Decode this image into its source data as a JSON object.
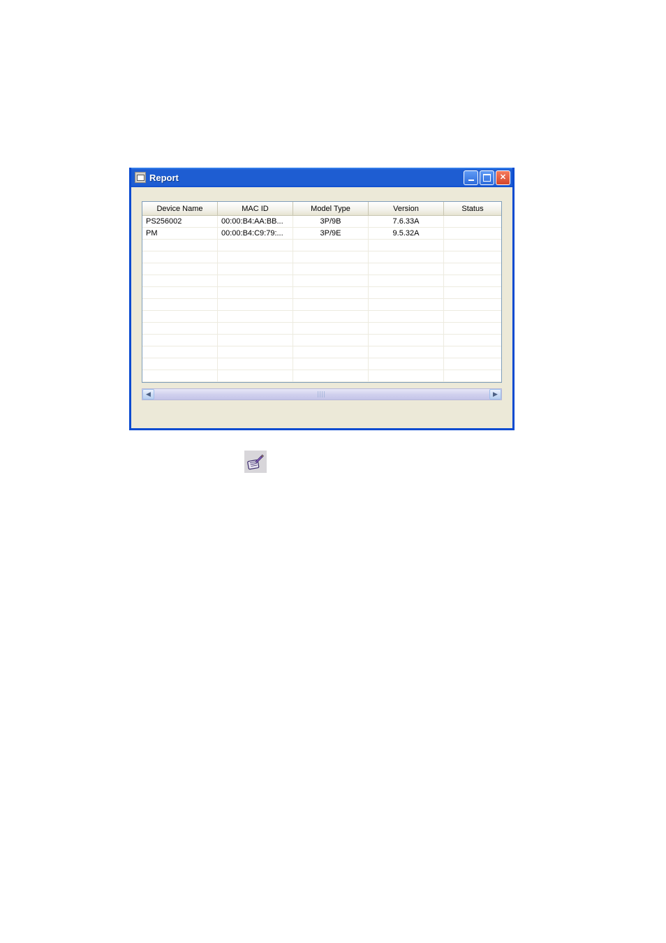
{
  "window": {
    "title": "Report"
  },
  "listview": {
    "columns": [
      "Device Name",
      "MAC ID",
      "Model Type",
      "Version",
      "Status"
    ],
    "rows": [
      {
        "device": "PS256002",
        "mac": "00:00:B4:AA:BB...",
        "model": "3P/9B",
        "version": "7.6.33A",
        "status": ""
      },
      {
        "device": "PM",
        "mac": "00:00:B4:C9:79:...",
        "model": "3P/9E",
        "version": "9.5.32A",
        "status": ""
      }
    ],
    "empty_rows": 12
  }
}
